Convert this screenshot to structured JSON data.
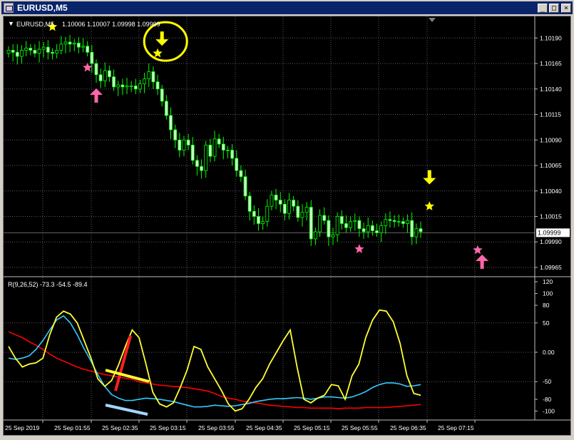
{
  "window": {
    "title": "EURUSD,M5",
    "buttons": {
      "minimize": "_",
      "maximize": "□",
      "close": "×"
    }
  },
  "colors": {
    "background": "#000000",
    "grid": "#5a5a5a",
    "candle_up": "#00ff00",
    "candle_down": "#c8ffc8",
    "price_line": "#c0c0c0",
    "rsi_fast": "#ff0000",
    "rsi_mid": "#33ccff",
    "rsi_slow": "#ffff33",
    "arrow_down": "#ffff00",
    "arrow_up": "#ff66aa",
    "annotation_circle": "#ffff00",
    "annotation_red": "#ff2020",
    "annotation_yellow": "#ffff33",
    "annotation_blue": "#a0d8ff"
  },
  "chart_data": [
    {
      "type": "candlestick",
      "title": "EURUSD,M5",
      "ohlc_header": "1.10006 1.10007 1.09998 1.09999",
      "current_price": "1.09999",
      "ylim": [
        1.09958,
        1.10207
      ],
      "y_ticks": [
        "1.10190",
        "1.10165",
        "1.10140",
        "1.10115",
        "1.10090",
        "1.10065",
        "1.10040",
        "1.10015",
        "1.09990",
        "1.09965"
      ],
      "y_tick_values": [
        1.1019,
        1.10165,
        1.1014,
        1.10115,
        1.1009,
        1.10065,
        1.1004,
        1.10015,
        1.0999,
        1.09965
      ],
      "current_price_value": 1.09999,
      "candles_count": 95,
      "closes": [
        1.10178,
        1.10176,
        1.10172,
        1.10178,
        1.1018,
        1.10178,
        1.10175,
        1.10179,
        1.10181,
        1.10176,
        1.10175,
        1.10178,
        1.10184,
        1.10186,
        1.10184,
        1.10185,
        1.10181,
        1.10182,
        1.10176,
        1.10165,
        1.10154,
        1.10148,
        1.10158,
        1.10152,
        1.10142,
        1.10144,
        1.10142,
        1.10143,
        1.10143,
        1.1014,
        1.10145,
        1.1015,
        1.10157,
        1.10147,
        1.1014,
        1.10128,
        1.10114,
        1.101,
        1.1009,
        1.1008,
        1.1009,
        1.10085,
        1.1007,
        1.10064,
        1.1006,
        1.10085,
        1.10074,
        1.10091,
        1.10086,
        1.1008,
        1.1008,
        1.10072,
        1.1006,
        1.10054,
        1.10035,
        1.1002,
        1.10015,
        1.10008,
        1.1001,
        1.10025,
        1.10036,
        1.10031,
        1.10027,
        1.10018,
        1.10031,
        1.10025,
        1.10014,
        1.10019,
        1.10024,
        1.09993,
        1.1,
        1.10016,
        1.10011,
        1.09995,
        1.09997,
        1.10015,
        1.10008,
        1.10004,
        1.1001,
        1.10011,
        1.10003,
        1.1,
        1.10006,
        1.10001,
        1.09999,
        1.10006,
        1.10012,
        1.10011,
        1.1001,
        1.1001,
        1.10008,
        1.10011,
        1.09995,
        1.10003,
        1.1
      ],
      "arrows": [
        {
          "kind": "down",
          "candle": 35,
          "price": 1.10188
        },
        {
          "kind": "up",
          "candle": 20,
          "price": 1.10135
        },
        {
          "kind": "down",
          "candle": 96,
          "price": 1.10052
        },
        {
          "kind": "up",
          "candle": 108,
          "price": 1.09972
        }
      ],
      "stars": [
        {
          "color": "yellow",
          "candle": 10,
          "price": 1.10201
        },
        {
          "color": "pink",
          "candle": 18,
          "price": 1.10161
        },
        {
          "color": "yellow",
          "candle": 34,
          "price": 1.10175
        },
        {
          "color": "pink",
          "candle": 80,
          "price": 1.09983
        },
        {
          "color": "yellow",
          "candle": 96,
          "price": 1.10025
        },
        {
          "color": "pink",
          "candle": 107,
          "price": 1.09982
        }
      ]
    },
    {
      "type": "line",
      "label": "R(9,26,52) -73.3 -54.5 -89.4",
      "ylim": [
        -108,
        125
      ],
      "y_ticks": [
        "120",
        "100",
        "80",
        "50",
        "0.00",
        "-50",
        "-80",
        "-100"
      ],
      "y_tick_values": [
        120,
        100,
        80,
        50,
        0,
        -50,
        -80,
        -100
      ],
      "series": [
        {
          "values": [
            10,
            -10,
            -25,
            -20,
            -18,
            -10,
            30,
            60,
            70,
            65,
            50,
            20,
            -10,
            -45,
            -58,
            -48,
            -22,
            10,
            38,
            25,
            -20,
            -68,
            -88,
            -93,
            -86,
            -60,
            -30,
            10,
            5,
            -25,
            -45,
            -65,
            -88,
            -100,
            -96,
            -80,
            -60,
            -45,
            -20,
            0,
            20,
            38,
            -25,
            -80,
            -86,
            -78,
            -73,
            -55,
            -57,
            -80,
            -40,
            -20,
            25,
            55,
            72,
            70,
            52,
            15,
            -40,
            -70,
            -73
          ]
        },
        {
          "values": [
            -10,
            -12,
            -10,
            -6,
            5,
            20,
            38,
            55,
            62,
            50,
            30,
            6,
            -15,
            -38,
            -58,
            -72,
            -78,
            -82,
            -82,
            -80,
            -78,
            -79,
            -80,
            -82,
            -84,
            -87,
            -90,
            -93,
            -93,
            -92,
            -90,
            -91,
            -92,
            -91,
            -89,
            -87,
            -84,
            -82,
            -80,
            -79,
            -79,
            -78,
            -77,
            -78,
            -80,
            -78,
            -76,
            -76,
            -77,
            -78,
            -76,
            -72,
            -67,
            -60,
            -55,
            -52,
            -52,
            -54,
            -58,
            -57,
            -55
          ]
        },
        {
          "values": [
            35,
            30,
            25,
            18,
            12,
            5,
            -3,
            -10,
            -15,
            -20,
            -25,
            -29,
            -32,
            -35,
            -38,
            -40,
            -42,
            -44,
            -46,
            -50,
            -52,
            -54,
            -56,
            -57,
            -58,
            -59,
            -60,
            -62,
            -64,
            -66,
            -70,
            -75,
            -78,
            -80,
            -83,
            -85,
            -86,
            -88,
            -90,
            -91,
            -92,
            -93,
            -94,
            -94,
            -95,
            -95,
            -95,
            -95,
            -96,
            -95,
            -95,
            -95,
            -94,
            -94,
            -94,
            -94,
            -93,
            -92,
            -91,
            -90,
            -89
          ]
        }
      ]
    }
  ],
  "x_axis_labels": [
    "25 Sep 2019",
    "25 Sep 01:55",
    "25 Sep 02:35",
    "25 Sep 03:15",
    "25 Sep 03:55",
    "25 Sep 04:35",
    "25 Sep 05:15",
    "25 Sep 05:55",
    "25 Sep 06:35",
    "25 Sep 07:15"
  ]
}
